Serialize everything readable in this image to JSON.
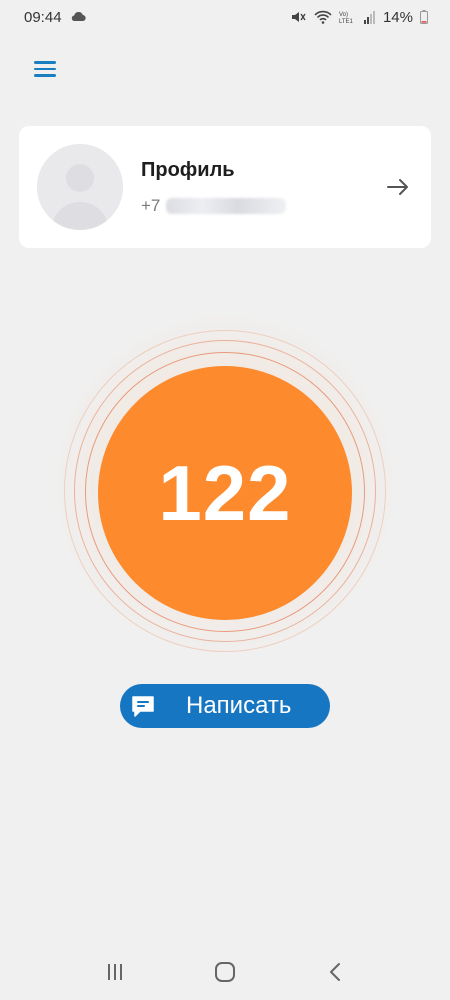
{
  "status_bar": {
    "time": "09:44",
    "battery": "14%",
    "network_label": "Vo) LTE1"
  },
  "profile": {
    "name": "Профиль",
    "phone_prefix": "+7"
  },
  "counter": {
    "value": "122"
  },
  "write_button": {
    "label": "Написать"
  },
  "colors": {
    "accent_blue": "#1676c2",
    "counter_orange": "#fd8a2d",
    "background": "#f0f0f0"
  },
  "icons": {
    "menu": "hamburger-icon",
    "arrow": "arrow-right-icon",
    "write": "chat-bubble-icon",
    "nav_recent": "recent-apps-icon",
    "nav_home": "home-icon",
    "nav_back": "back-icon"
  }
}
